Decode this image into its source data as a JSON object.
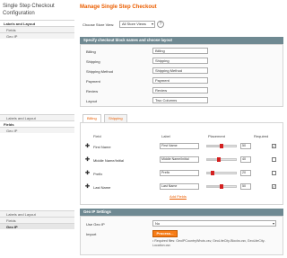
{
  "sidebar": {
    "title": "Single Step Checkout Configuration",
    "groups": [
      {
        "items": [
          "Labels and Layout",
          "Fields",
          "Geo IP"
        ]
      },
      {
        "items": [
          "Labels and Layout",
          "Fields",
          "Geo IP"
        ]
      },
      {
        "items": [
          "Labels and Layout",
          "Fields",
          "Geo IP"
        ]
      }
    ]
  },
  "main": {
    "title": "Manage Single Step Checkout",
    "store_label": "Choose Store View:",
    "store_value": "All Store Views",
    "section1_title": "Specify checkout block names and choose layout",
    "blocks": [
      {
        "label": "Billing",
        "value": "Billing"
      },
      {
        "label": "Shipping",
        "value": "Shipping"
      },
      {
        "label": "Shipping Method",
        "value": "Shipping Method"
      },
      {
        "label": "Payment",
        "value": "Payment"
      },
      {
        "label": "Review",
        "value": "Review"
      },
      {
        "label": "Layout",
        "value": "Two Columns"
      }
    ],
    "tabs": [
      "Billing",
      "Shipping"
    ],
    "table_headers": {
      "field": "Field",
      "label": "Label",
      "placement": "Placement",
      "required": "Required"
    },
    "fields": [
      {
        "field": "First Name",
        "label": "First Name",
        "placement": 50,
        "placement_fraction": 0.5,
        "required": true
      },
      {
        "field": "Middle Name/Initial",
        "label": "Middle Name/Initial",
        "placement": 40,
        "placement_fraction": 0.4,
        "required": false
      },
      {
        "field": "Prefix",
        "label": "Prefix",
        "placement": 20,
        "placement_fraction": 0.2,
        "required": false
      },
      {
        "field": "Last Name",
        "label": "Last Name",
        "placement": 50,
        "placement_fraction": 0.5,
        "required": true
      }
    ],
    "add_fields": "Add Fields",
    "geo_title": "Geo IP Settings",
    "use_geo_label": "Use Geo IP",
    "use_geo_value": "No",
    "import_label": "Import",
    "import_button": "Process...",
    "import_note": "• Required files: GeoIPCountryWhois.csv, GeoLiteCity-Blocks.csv, GeoLiteCity-Location.csv"
  }
}
